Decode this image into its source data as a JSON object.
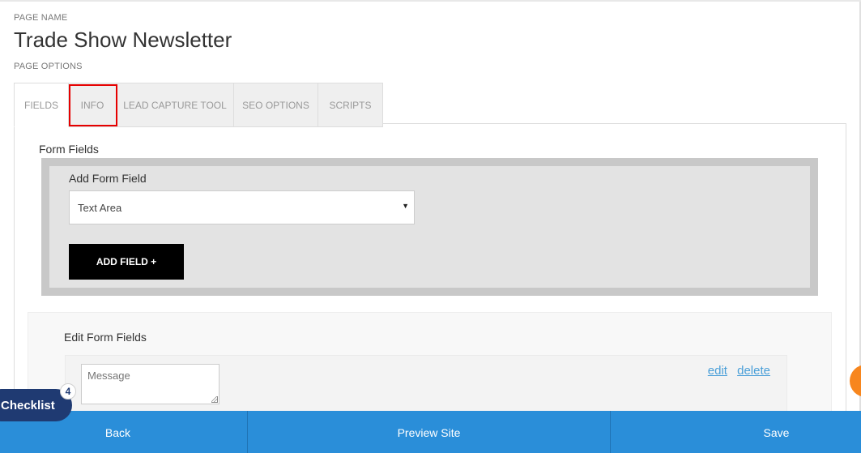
{
  "page": {
    "name_label": "PAGE NAME",
    "title": "Trade Show Newsletter",
    "options_label": "PAGE OPTIONS"
  },
  "tabs": [
    {
      "label": "FIELDS",
      "active": true
    },
    {
      "label": "INFO",
      "active": false,
      "highlighted": true
    },
    {
      "label": "LEAD CAPTURE TOOL",
      "active": false
    },
    {
      "label": "SEO OPTIONS",
      "active": false
    },
    {
      "label": "SCRIPTS",
      "active": false
    }
  ],
  "form_fields": {
    "title": "Form Fields",
    "add": {
      "title": "Add Form Field",
      "selected_type": "Text Area",
      "button_label": "ADD FIELD +"
    },
    "edit": {
      "title": "Edit Form Fields",
      "rows": [
        {
          "placeholder": "Message",
          "edit_label": "edit",
          "delete_label": "delete"
        }
      ]
    }
  },
  "bottom_bar": {
    "back_label": "Back",
    "preview_label": "Preview Site",
    "save_label": "Save"
  },
  "checklist": {
    "label": "Checklist",
    "count": "4"
  },
  "colors": {
    "primary_blue": "#2a8ed9",
    "checklist_navy": "#1f3a72",
    "highlight_red": "#e60000",
    "link_blue": "#4a9fd8",
    "accent_orange": "#f7861e"
  }
}
